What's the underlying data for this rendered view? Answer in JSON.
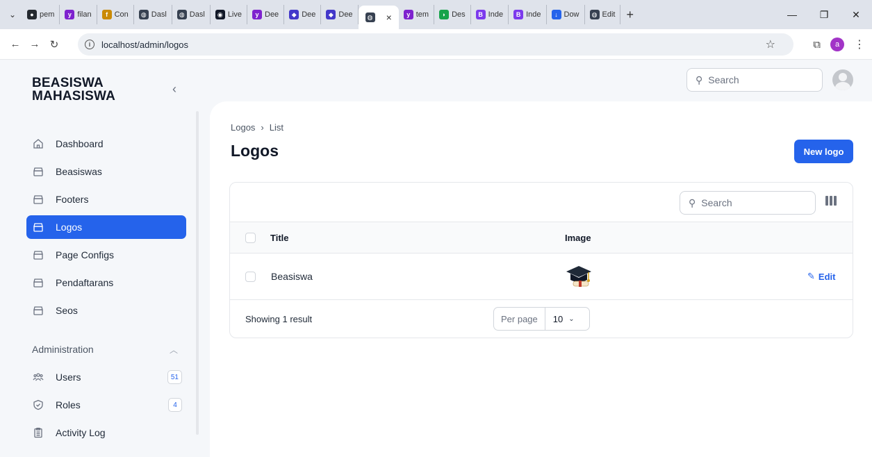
{
  "browser": {
    "tabs": [
      {
        "label": "pem",
        "icon": "github-icon",
        "color": "#24292f"
      },
      {
        "label": "filan",
        "icon": "yii-icon",
        "color": "#7e22ce"
      },
      {
        "label": "Con",
        "icon": "filament-icon",
        "color": "#ca8a04"
      },
      {
        "label": "Dasl",
        "icon": "globe-icon",
        "color": "#374151"
      },
      {
        "label": "Dasl",
        "icon": "globe-icon",
        "color": "#374151"
      },
      {
        "label": "Live",
        "icon": "live-icon",
        "color": "#111827"
      },
      {
        "label": "Dee",
        "icon": "yii-icon",
        "color": "#7e22ce"
      },
      {
        "label": "Dee",
        "icon": "deepl-icon",
        "color": "#4338ca"
      },
      {
        "label": "Dee",
        "icon": "deepl-icon",
        "color": "#4338ca"
      },
      {
        "label": "",
        "icon": "globe-icon",
        "color": "#374151",
        "active": true
      },
      {
        "label": "tem",
        "icon": "yii-icon",
        "color": "#7e22ce"
      },
      {
        "label": "Des",
        "icon": "figma-icon",
        "color": "#16a34a"
      },
      {
        "label": "Inde",
        "icon": "bootstrap-icon",
        "color": "#7c3aed"
      },
      {
        "label": "Inde",
        "icon": "bootstrap-icon",
        "color": "#7c3aed"
      },
      {
        "label": "Dow",
        "icon": "download-icon",
        "color": "#2563eb"
      },
      {
        "label": "Edit",
        "icon": "globe-icon",
        "color": "#374151"
      }
    ],
    "url": "localhost/admin/logos",
    "profile_initial": "a"
  },
  "app": {
    "brand_line1": "BEASISWA",
    "brand_line2": "MAHASISWA",
    "top_search_placeholder": "Search",
    "sidebar": {
      "items": [
        {
          "label": "Dashboard",
          "icon": "home-icon",
          "active": false
        },
        {
          "label": "Beasiswas",
          "icon": "archive-icon",
          "active": false
        },
        {
          "label": "Footers",
          "icon": "archive-icon",
          "active": false
        },
        {
          "label": "Logos",
          "icon": "archive-icon",
          "active": true
        },
        {
          "label": "Page Configs",
          "icon": "archive-icon",
          "active": false
        },
        {
          "label": "Pendaftarans",
          "icon": "archive-icon",
          "active": false
        },
        {
          "label": "Seos",
          "icon": "archive-icon",
          "active": false
        }
      ],
      "group_label": "Administration",
      "admin_items": [
        {
          "label": "Users",
          "icon": "users-icon",
          "badge": "51"
        },
        {
          "label": "Roles",
          "icon": "shield-icon",
          "badge": "4"
        },
        {
          "label": "Activity Log",
          "icon": "clipboard-icon",
          "badge": ""
        }
      ]
    },
    "main": {
      "breadcrumb": [
        "Logos",
        "List"
      ],
      "title": "Logos",
      "new_button": "New logo",
      "table": {
        "search_placeholder": "Search",
        "columns": [
          "Title",
          "Image"
        ],
        "rows": [
          {
            "title": "Beasiswa",
            "image": "graduation-cap-icon",
            "action": "Edit"
          }
        ],
        "showing": "Showing 1 result",
        "per_page_label": "Per page",
        "per_page_value": "10"
      }
    },
    "accent_color": "#2563eb"
  }
}
